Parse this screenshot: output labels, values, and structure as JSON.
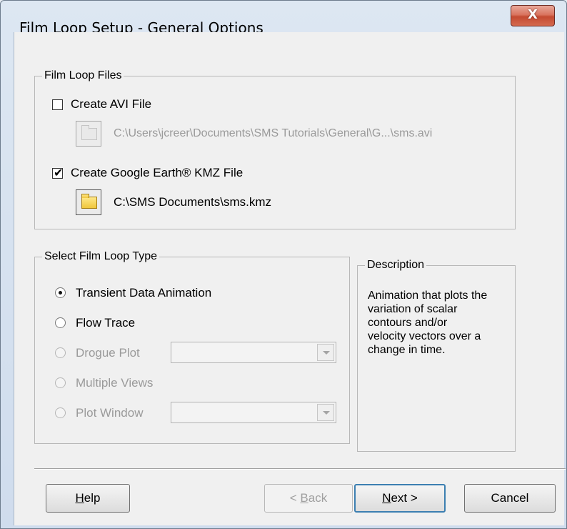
{
  "window": {
    "title": "Film Loop Setup - General Options",
    "close_label": "X"
  },
  "film_loop_files": {
    "group_label": "Film Loop Files",
    "create_avi": {
      "label": "Create AVI File",
      "checked": false
    },
    "avi_path": "C:\\Users\\jcreer\\Documents\\SMS Tutorials\\General\\G...\\sms.avi",
    "create_kmz": {
      "label": "Create Google Earth® KMZ File",
      "checked": true,
      "check_glyph": "✔"
    },
    "kmz_path": "C:\\SMS Documents\\sms.kmz"
  },
  "film_loop_type": {
    "group_label": "Select Film Loop Type",
    "options": [
      {
        "label": "Transient Data Animation",
        "selected": true,
        "enabled": true
      },
      {
        "label": "Flow Trace",
        "selected": false,
        "enabled": true
      },
      {
        "label": "Drogue Plot",
        "selected": false,
        "enabled": false
      },
      {
        "label": "Multiple Views",
        "selected": false,
        "enabled": false
      },
      {
        "label": "Plot Window",
        "selected": false,
        "enabled": false
      }
    ]
  },
  "description": {
    "group_label": "Description",
    "text": "Animation that plots the\nvariation of scalar\ncontours and/or\nvelocity vectors over a\nchange in time."
  },
  "buttons": {
    "help_hotkey": "H",
    "help_rest": "elp",
    "back_prefix": "< ",
    "back_hotkey": "B",
    "back_rest": "ack",
    "next_hotkey": "N",
    "next_rest": "ext >",
    "cancel": "Cancel"
  },
  "colors": {
    "dialog_bg": "#f0f0f0",
    "close_button": "#c44a31",
    "default_button_border": "#3c7fb1",
    "disabled_text": "#9a9a9a"
  },
  "icons": {
    "close": "close-icon",
    "folder": "folder-icon",
    "dropdown": "chevron-down-icon"
  }
}
